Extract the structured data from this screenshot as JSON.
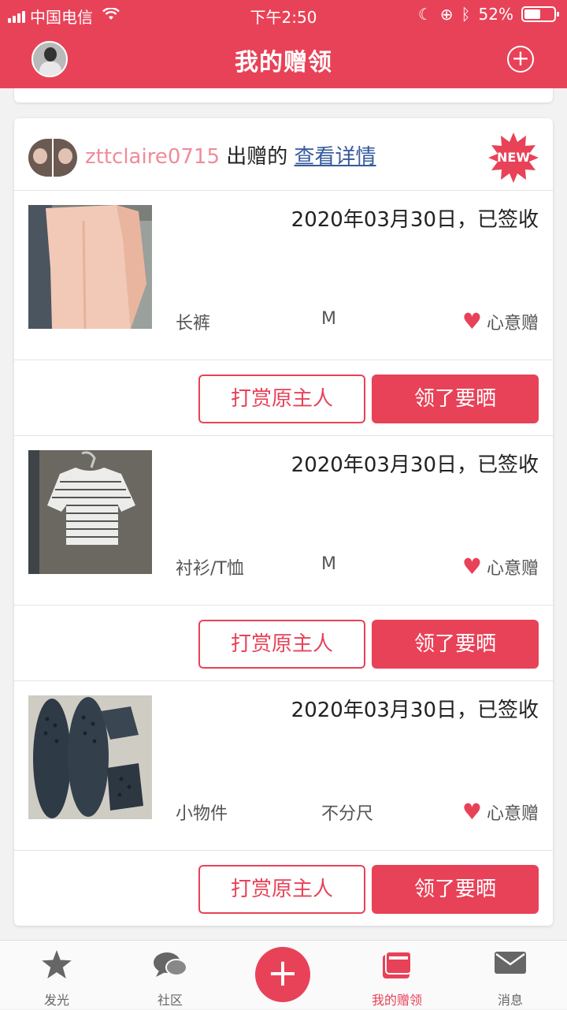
{
  "status": {
    "carrier": "中国电信",
    "time": "下午2:50",
    "battery": "52%",
    "battery_level": 0.52
  },
  "header": {
    "title": "我的赠领",
    "add_icon": "plus-circle-icon"
  },
  "card": {
    "user": "zttclaire0715",
    "verb": "出赠的",
    "link": "查看详情",
    "badge": "NEW",
    "items": [
      {
        "date": "2020年03月30日，已签收",
        "category": "长裤",
        "size": "M",
        "gift": "心意赠",
        "btn_reward": "打赏原主人",
        "btn_show": "领了要晒"
      },
      {
        "date": "2020年03月30日，已签收",
        "category": "衬衫/T恤",
        "size": "M",
        "gift": "心意赠",
        "btn_reward": "打赏原主人",
        "btn_show": "领了要晒"
      },
      {
        "date": "2020年03月30日，已签收",
        "category": "小物件",
        "size": "不分尺",
        "gift": "心意赠",
        "btn_reward": "打赏原主人",
        "btn_show": "领了要晒"
      }
    ]
  },
  "tabbar": {
    "tabs": [
      {
        "label": "发光",
        "icon": "star-icon"
      },
      {
        "label": "社区",
        "icon": "chat-bubbles-icon"
      },
      {
        "label": "",
        "icon": "plus-icon"
      },
      {
        "label": "我的赠领",
        "icon": "gift-box-icon"
      },
      {
        "label": "消息",
        "icon": "envelope-icon"
      }
    ]
  },
  "colors": {
    "accent": "#e84258",
    "username": "#ef8c99",
    "link": "#355a9c"
  }
}
